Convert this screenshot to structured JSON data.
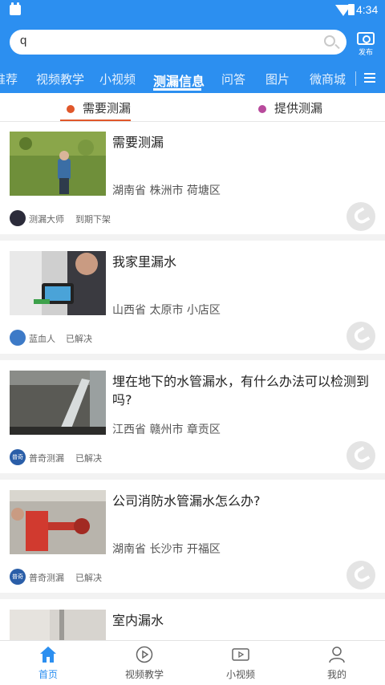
{
  "status_bar": {
    "time": "4:34",
    "icons": [
      "app-icon",
      "wifi-icon",
      "battery-icon"
    ]
  },
  "search": {
    "value": "q",
    "icon": "search-icon"
  },
  "publish": {
    "label": "发布",
    "icon": "camera-icon"
  },
  "nav_tabs": [
    {
      "label": "推荐",
      "active": false
    },
    {
      "label": "视频教学",
      "active": false
    },
    {
      "label": "小视频",
      "active": false
    },
    {
      "label": "测漏信息",
      "active": true
    },
    {
      "label": "问答",
      "active": false
    },
    {
      "label": "图片",
      "active": false
    },
    {
      "label": "微商城",
      "active": false
    }
  ],
  "sub_tabs": [
    {
      "label": "需要测漏",
      "active": true,
      "dot_color": "#e0572a"
    },
    {
      "label": "提供测漏",
      "active": false,
      "dot_color": "#b84a9c"
    }
  ],
  "posts": [
    {
      "title": "需要测漏",
      "location": "湖南省 株洲市 荷塘区",
      "author": "测漏大师",
      "status": "到期下架",
      "avatar_text": ""
    },
    {
      "title": "我家里漏水",
      "location": "山西省 太原市 小店区",
      "author": "蓝血人",
      "status": "已解决",
      "avatar_text": ""
    },
    {
      "title": "埋在地下的水管漏水，有什么办法可以检测到吗?",
      "location": "江西省 赣州市 章贡区",
      "author": "普奇测漏",
      "status": "已解决",
      "avatar_text": "普奇"
    },
    {
      "title": "公司消防水管漏水怎么办?",
      "location": "湖南省 长沙市 开福区",
      "author": "普奇测漏",
      "status": "已解决",
      "avatar_text": "普奇"
    },
    {
      "title": "室内漏水",
      "location": "",
      "author": "",
      "status": "",
      "avatar_text": ""
    }
  ],
  "bottom_nav": [
    {
      "label": "首页",
      "icon": "home-icon",
      "active": true
    },
    {
      "label": "视频教学",
      "icon": "video-play-icon",
      "active": false
    },
    {
      "label": "小视频",
      "icon": "short-video-icon",
      "active": false
    },
    {
      "label": "我的",
      "icon": "user-icon",
      "active": false
    }
  ],
  "colors": {
    "brand_blue": "#2c8ff0",
    "active_underline": "#e0572a",
    "phone_button": "#e4e4e4"
  }
}
